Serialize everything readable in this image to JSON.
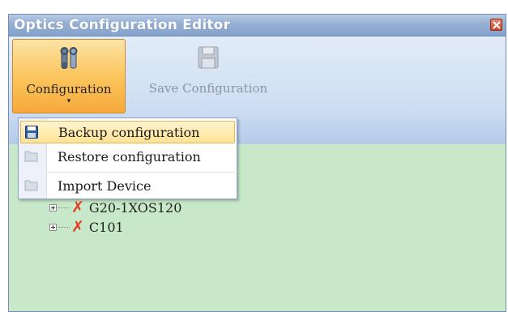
{
  "window": {
    "title": "Optics Configuration Editor"
  },
  "ribbon": {
    "configuration_label": "Configuration",
    "configuration_arrow": "▾",
    "save_label": "Save Configuration"
  },
  "menu": {
    "items": [
      {
        "label": "Backup configuration",
        "icon": "floppy-disk-icon",
        "highlighted": true
      },
      {
        "label": "Restore configuration",
        "icon": "folder-icon",
        "highlighted": false
      },
      {
        "label": "Import Device",
        "icon": "folder-icon",
        "highlighted": false
      }
    ]
  },
  "tree": {
    "items": [
      {
        "label": "G20-1XOS120",
        "icon": "red-x-icon"
      },
      {
        "label": "C101",
        "icon": "red-x-icon"
      }
    ]
  },
  "colors": {
    "accent": "#f6a93a",
    "titlebar": "#95aed3",
    "content_bg": "#c7e8c9",
    "error": "#e6391b"
  }
}
